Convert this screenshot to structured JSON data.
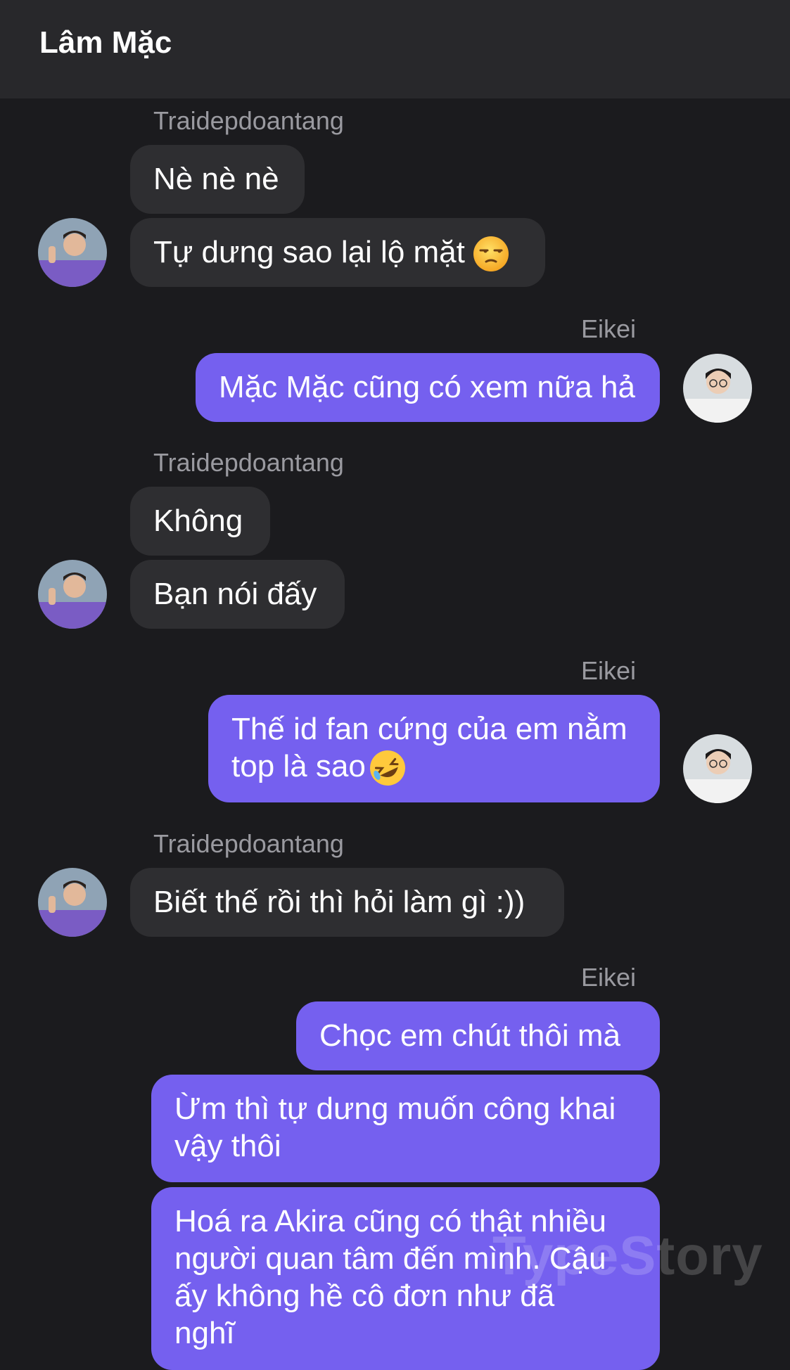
{
  "header": {
    "title": "Lâm Mặc"
  },
  "participants": {
    "them": "Traidepdoantang",
    "me": "Eikei"
  },
  "messages": [
    {
      "sender": "Traidepdoantang",
      "text": "Nè nè nè"
    },
    {
      "sender": "Traidepdoantang",
      "text": "Tự dưng sao lại lộ mặt",
      "emoji": "unamused-face"
    },
    {
      "sender": "Eikei",
      "text": "Mặc Mặc cũng có xem nữa hả"
    },
    {
      "sender": "Traidepdoantang",
      "text": "Không"
    },
    {
      "sender": "Traidepdoantang",
      "text": "Bạn nói đấy"
    },
    {
      "sender": "Eikei",
      "text_line1": "Thế id fan cứng của em nằm",
      "text_line2": "top là sao",
      "emoji": "rolling-on-floor-laughing"
    },
    {
      "sender": "Traidepdoantang",
      "text": "Biết thế rồi thì hỏi làm gì :))"
    },
    {
      "sender": "Eikei",
      "text": "Chọc em chút thôi mà"
    },
    {
      "sender": "Eikei",
      "text_line1": "Ừm thì tự dưng muốn công khai",
      "text_line2": "vậy thôi"
    },
    {
      "sender": "Eikei",
      "text_line1": "Hoá ra Akira cũng có thật nhiều",
      "text_line2": "người quan tâm đến mình. Cậu",
      "text_line3": "ấy không hề cô đơn như đã",
      "text_line4": "nghĩ"
    }
  ],
  "watermark": "TypeStory",
  "colors": {
    "background": "#1b1b1e",
    "header": "#28282b",
    "incoming_bubble": "#2e2e31",
    "outgoing_bubble": "#7560ef",
    "sender_name": "#9a9aa0"
  }
}
